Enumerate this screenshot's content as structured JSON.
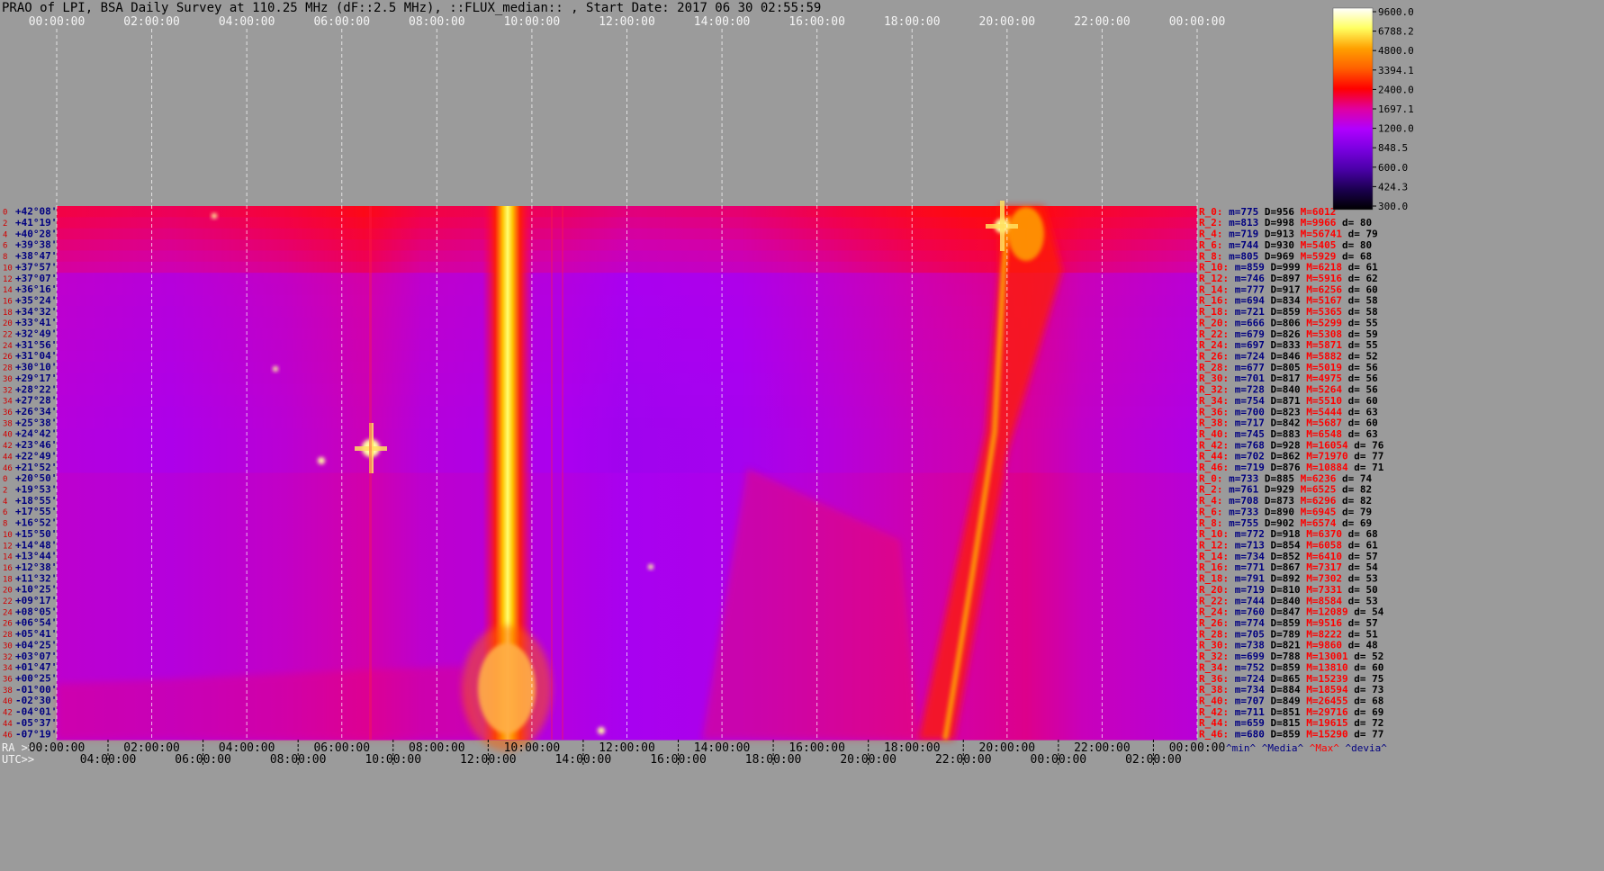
{
  "title": "PRAO of LPI, BSA Daily Survey at 110.25 MHz (dF::2.5 MHz), ::FLUX_median:: , Start Date: 2017 06 30 02:55:59",
  "chart_data": {
    "type": "heatmap",
    "top_axis_ticks": [
      "00:00:00",
      "02:00:00",
      "04:00:00",
      "06:00:00",
      "08:00:00",
      "10:00:00",
      "12:00:00",
      "14:00:00",
      "16:00:00",
      "18:00:00",
      "20:00:00",
      "22:00:00",
      "00:00:00"
    ],
    "ra_axis_label": "RA >>",
    "ra_axis_ticks": [
      "00:00:00",
      "02:00:00",
      "04:00:00",
      "06:00:00",
      "08:00:00",
      "10:00:00",
      "12:00:00",
      "14:00:00",
      "16:00:00",
      "18:00:00",
      "20:00:00",
      "22:00:00",
      "00:00:00"
    ],
    "utc_axis_label": "UTC>>",
    "utc_axis_ticks": [
      "04:00:00",
      "06:00:00",
      "08:00:00",
      "10:00:00",
      "12:00:00",
      "14:00:00",
      "16:00:00",
      "18:00:00",
      "20:00:00",
      "22:00:00",
      "00:00:00",
      "02:00:00"
    ],
    "colorbar": {
      "ticks": [
        "9600.0",
        "6788.2",
        "4800.0",
        "3394.1",
        "2400.0",
        "1697.1",
        "1200.0",
        "848.5",
        "600.0",
        "424.3",
        "300.0"
      ],
      "colors": [
        "#000000",
        "#1b0050",
        "#4a00a8",
        "#7a00e0",
        "#b000ff",
        "#ff0000",
        "#ff6000",
        "#ffa000",
        "#ffe000",
        "#ffff90",
        "#ffffff"
      ]
    },
    "row_index_labels": [
      "0",
      "2",
      "4",
      "6",
      "8",
      "10",
      "12",
      "14",
      "16",
      "18",
      "20",
      "22",
      "24",
      "26",
      "28",
      "30",
      "32",
      "34",
      "36",
      "38",
      "40",
      "42",
      "44",
      "46",
      "0",
      "2",
      "4",
      "6",
      "8",
      "10",
      "12",
      "14",
      "16",
      "18",
      "20",
      "22",
      "24",
      "26",
      "28",
      "30",
      "32",
      "34",
      "36",
      "38",
      "40",
      "42",
      "44",
      "46"
    ],
    "declinations": [
      "+42°08'",
      "+41°19'",
      "+40°28'",
      "+39°38'",
      "+38°47'",
      "+37°57'",
      "+37°07'",
      "+36°16'",
      "+35°24'",
      "+34°32'",
      "+33°41'",
      "+32°49'",
      "+31°56'",
      "+31°04'",
      "+30°10'",
      "+29°17'",
      "+28°22'",
      "+27°28'",
      "+26°34'",
      "+25°38'",
      "+24°42'",
      "+23°46'",
      "+22°49'",
      "+21°52'",
      "+20°50'",
      "+19°53'",
      "+18°55'",
      "+17°55'",
      "+16°52'",
      "+15°50'",
      "+14°48'",
      "+13°44'",
      "+12°38'",
      "+11°32'",
      "+10°25'",
      "+09°17'",
      "+08°05'",
      "+06°54'",
      "+05°41'",
      "+04°25'",
      "+03°07'",
      "+01°47'",
      "+00°25'",
      "-01°00'",
      "-02°30'",
      "-04°01'",
      "-05°37'",
      "-07°19'"
    ],
    "row_stats": [
      {
        "r": "R_0:",
        "m": "m=775",
        "d": "D=956",
        "x": "M=6012",
        "v": ""
      },
      {
        "r": "R_2:",
        "m": "m=813",
        "d": "D=998",
        "x": "M=9966",
        "v": "d= 80"
      },
      {
        "r": "R_4:",
        "m": "m=719",
        "d": "D=913",
        "x": "M=56741",
        "v": "d= 79"
      },
      {
        "r": "R_6:",
        "m": "m=744",
        "d": "D=930",
        "x": "M=5405",
        "v": "d= 80"
      },
      {
        "r": "R_8:",
        "m": "m=805",
        "d": "D=969",
        "x": "M=5929",
        "v": "d= 68"
      },
      {
        "r": "R_10:",
        "m": "m=859",
        "d": "D=999",
        "x": "M=6218",
        "v": "d= 61"
      },
      {
        "r": "R_12:",
        "m": "m=746",
        "d": "D=897",
        "x": "M=5916",
        "v": "d= 62"
      },
      {
        "r": "R_14:",
        "m": "m=777",
        "d": "D=917",
        "x": "M=6256",
        "v": "d= 60"
      },
      {
        "r": "R_16:",
        "m": "m=694",
        "d": "D=834",
        "x": "M=5167",
        "v": "d= 58"
      },
      {
        "r": "R_18:",
        "m": "m=721",
        "d": "D=859",
        "x": "M=5365",
        "v": "d= 58"
      },
      {
        "r": "R_20:",
        "m": "m=666",
        "d": "D=806",
        "x": "M=5299",
        "v": "d= 55"
      },
      {
        "r": "R_22:",
        "m": "m=679",
        "d": "D=826",
        "x": "M=5308",
        "v": "d= 59"
      },
      {
        "r": "R_24:",
        "m": "m=697",
        "d": "D=833",
        "x": "M=5871",
        "v": "d= 55"
      },
      {
        "r": "R_26:",
        "m": "m=724",
        "d": "D=846",
        "x": "M=5882",
        "v": "d= 52"
      },
      {
        "r": "R_28:",
        "m": "m=677",
        "d": "D=805",
        "x": "M=5019",
        "v": "d= 56"
      },
      {
        "r": "R_30:",
        "m": "m=701",
        "d": "D=817",
        "x": "M=4975",
        "v": "d= 56"
      },
      {
        "r": "R_32:",
        "m": "m=728",
        "d": "D=840",
        "x": "M=5264",
        "v": "d= 56"
      },
      {
        "r": "R_34:",
        "m": "m=754",
        "d": "D=871",
        "x": "M=5510",
        "v": "d= 60"
      },
      {
        "r": "R_36:",
        "m": "m=700",
        "d": "D=823",
        "x": "M=5444",
        "v": "d= 63"
      },
      {
        "r": "R_38:",
        "m": "m=717",
        "d": "D=842",
        "x": "M=5687",
        "v": "d= 60"
      },
      {
        "r": "R_40:",
        "m": "m=745",
        "d": "D=883",
        "x": "M=6548",
        "v": "d= 63"
      },
      {
        "r": "R_42:",
        "m": "m=768",
        "d": "D=928",
        "x": "M=16054",
        "v": "d= 76"
      },
      {
        "r": "R_44:",
        "m": "m=702",
        "d": "D=862",
        "x": "M=71970",
        "v": "d= 77"
      },
      {
        "r": "R_46:",
        "m": "m=719",
        "d": "D=876",
        "x": "M=10884",
        "v": "d= 71"
      },
      {
        "r": "R_0:",
        "m": "m=733",
        "d": "D=885",
        "x": "M=6236",
        "v": "d= 74"
      },
      {
        "r": "R_2:",
        "m": "m=761",
        "d": "D=929",
        "x": "M=6525",
        "v": "d= 82"
      },
      {
        "r": "R_4:",
        "m": "m=708",
        "d": "D=873",
        "x": "M=6296",
        "v": "d= 82"
      },
      {
        "r": "R_6:",
        "m": "m=733",
        "d": "D=890",
        "x": "M=6945",
        "v": "d= 79"
      },
      {
        "r": "R_8:",
        "m": "m=755",
        "d": "D=902",
        "x": "M=6574",
        "v": "d= 69"
      },
      {
        "r": "R_10:",
        "m": "m=772",
        "d": "D=918",
        "x": "M=6370",
        "v": "d= 68"
      },
      {
        "r": "R_12:",
        "m": "m=713",
        "d": "D=854",
        "x": "M=6058",
        "v": "d= 61"
      },
      {
        "r": "R_14:",
        "m": "m=734",
        "d": "D=852",
        "x": "M=6410",
        "v": "d= 57"
      },
      {
        "r": "R_16:",
        "m": "m=771",
        "d": "D=867",
        "x": "M=7317",
        "v": "d= 54"
      },
      {
        "r": "R_18:",
        "m": "m=791",
        "d": "D=892",
        "x": "M=7302",
        "v": "d= 53"
      },
      {
        "r": "R_20:",
        "m": "m=719",
        "d": "D=810",
        "x": "M=7331",
        "v": "d= 50"
      },
      {
        "r": "R_22:",
        "m": "m=744",
        "d": "D=840",
        "x": "M=8584",
        "v": "d= 53"
      },
      {
        "r": "R_24:",
        "m": "m=760",
        "d": "D=847",
        "x": "M=12089",
        "v": "d= 54"
      },
      {
        "r": "R_26:",
        "m": "m=774",
        "d": "D=859",
        "x": "M=9516",
        "v": "d= 57"
      },
      {
        "r": "R_28:",
        "m": "m=705",
        "d": "D=789",
        "x": "M=8222",
        "v": "d= 51"
      },
      {
        "r": "R_30:",
        "m": "m=738",
        "d": "D=821",
        "x": "M=9860",
        "v": "d= 48"
      },
      {
        "r": "R_32:",
        "m": "m=699",
        "d": "D=788",
        "x": "M=13001",
        "v": "d= 52"
      },
      {
        "r": "R_34:",
        "m": "m=752",
        "d": "D=859",
        "x": "M=13810",
        "v": "d= 60"
      },
      {
        "r": "R_36:",
        "m": "m=724",
        "d": "D=865",
        "x": "M=15239",
        "v": "d= 75"
      },
      {
        "r": "R_38:",
        "m": "m=734",
        "d": "D=884",
        "x": "M=18594",
        "v": "d= 73"
      },
      {
        "r": "R_40:",
        "m": "m=707",
        "d": "D=849",
        "x": "M=26455",
        "v": "d= 68"
      },
      {
        "r": "R_42:",
        "m": "m=711",
        "d": "D=851",
        "x": "M=29716",
        "v": "d= 69"
      },
      {
        "r": "R_44:",
        "m": "m=659",
        "d": "D=815",
        "x": "M=19615",
        "v": "d= 72"
      },
      {
        "r": "R_46:",
        "m": "m=680",
        "d": "D=859",
        "x": "M=15290",
        "v": "d= 77"
      }
    ],
    "stats_footer": [
      "^min^",
      "^Media^",
      "^Max^",
      "^devia^"
    ],
    "colors": {
      "background": "#9b9b9b",
      "row_label_red": "#d00000",
      "stat_blue": "#000080",
      "stat_max_red": "#ff0000"
    }
  }
}
